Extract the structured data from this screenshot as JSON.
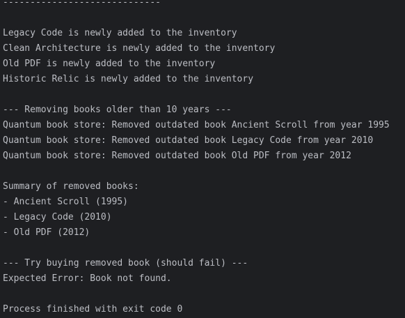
{
  "console": {
    "lines": [
      "-----------------------------",
      "",
      "Legacy Code is newly added to the inventory",
      "Clean Architecture is newly added to the inventory",
      "Old PDF is newly added to the inventory",
      "Historic Relic is newly added to the inventory",
      "",
      "--- Removing books older than 10 years ---",
      "Quantum book store: Removed outdated book Ancient Scroll from year 1995",
      "Quantum book store: Removed outdated book Legacy Code from year 2010",
      "Quantum book store: Removed outdated book Old PDF from year 2012",
      "",
      "Summary of removed books:",
      "- Ancient Scroll (1995)",
      "- Legacy Code (2010)",
      "- Old PDF (2012)",
      "",
      "--- Try buying removed book (should fail) ---",
      "Expected Error: Book not found.",
      "",
      "Process finished with exit code 0"
    ]
  }
}
